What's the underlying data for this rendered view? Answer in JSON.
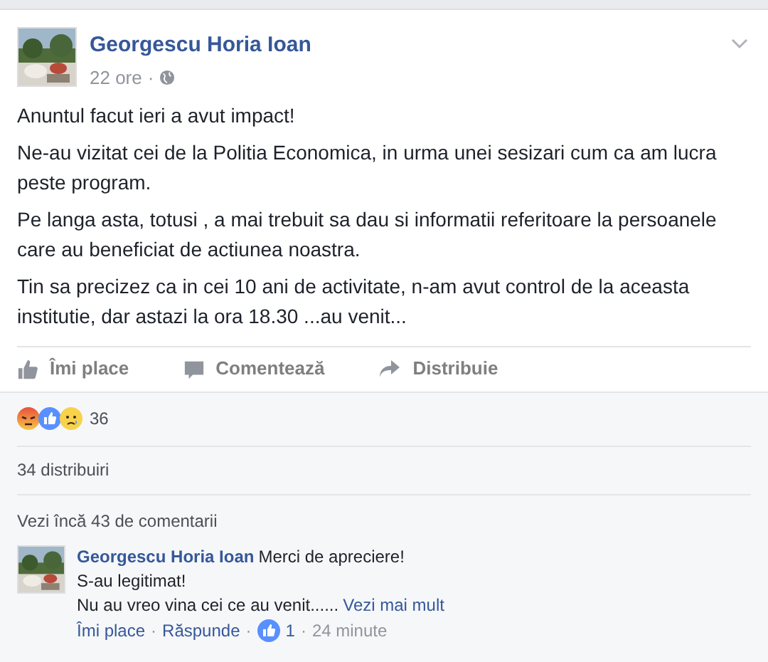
{
  "post": {
    "author": "Georgescu Horia Ioan",
    "time": "22 ore",
    "separator": "·",
    "paragraphs": [
      "Anuntul facut ieri a avut impact!",
      "Ne-au vizitat cei de la Politia Economica, in urma unei sesizari cum ca am lucra peste program.",
      "Pe langa asta, totusi , a mai trebuit sa dau si informatii referitoare la persoanele care au beneficiat de actiunea noastra.",
      "Tin sa precizez ca in cei 10 ani de activitate, n-am avut control de la aceasta institutie, dar astazi la ora 18.30 ...au venit..."
    ]
  },
  "actions": [
    {
      "kind": "like",
      "label": "Îmi place"
    },
    {
      "kind": "comment",
      "label": "Comentează"
    },
    {
      "kind": "share",
      "label": "Distribuie"
    }
  ],
  "reactions": {
    "icons": [
      {
        "kind": "angry"
      },
      {
        "kind": "like"
      },
      {
        "kind": "sad"
      }
    ],
    "count": "36"
  },
  "shares": "34 distribuiri",
  "more_comments": "Vezi încă 43 de comentarii",
  "comment": {
    "author": "Georgescu Horia Ioan",
    "lines": [
      "Merci de apreciere!",
      "S-au legitimat!",
      "Nu au vreo vina cei ce au venit......"
    ],
    "see_more": "Vezi mai mult",
    "like": "Îmi place",
    "sep": "·",
    "reply": "Răspunde",
    "likes": "1",
    "time": "24 minute"
  }
}
